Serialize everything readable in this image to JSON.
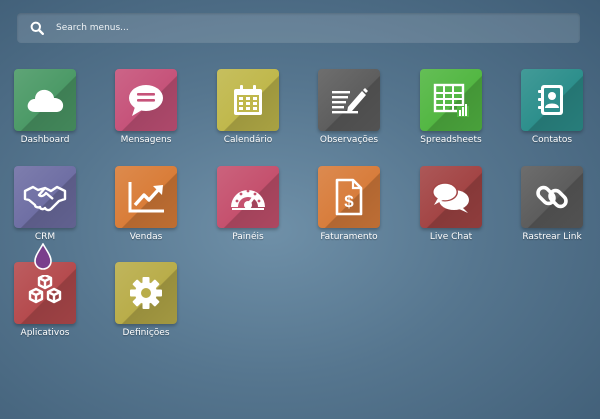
{
  "search": {
    "placeholder": "Search menus..."
  },
  "apps": [
    {
      "label": "Dashboard",
      "icon": "cloud-icon",
      "color": "#4c9a67"
    },
    {
      "label": "Mensagens",
      "icon": "chat-bubble-icon",
      "color": "#c6537a"
    },
    {
      "label": "Calendário",
      "icon": "calendar-icon",
      "color": "#c0b84c"
    },
    {
      "label": "Observações",
      "icon": "notes-pencil-icon",
      "color": "#5e5e5e"
    },
    {
      "label": "Spreadsheets",
      "icon": "spreadsheet-icon",
      "color": "#53b743"
    },
    {
      "label": "Contatos",
      "icon": "contact-book-icon",
      "color": "#2d8f8c"
    },
    {
      "label": "CRM",
      "icon": "handshake-icon",
      "color": "#6f6fa4"
    },
    {
      "label": "Vendas",
      "icon": "trend-chart-icon",
      "color": "#d97d39"
    },
    {
      "label": "Painéis",
      "icon": "gauge-icon",
      "color": "#c5516e"
    },
    {
      "label": "Faturamento",
      "icon": "invoice-dollar-icon",
      "color": "#d87d3c"
    },
    {
      "label": "Live Chat",
      "icon": "two-bubbles-icon",
      "color": "#a34545"
    },
    {
      "label": "Rastrear Link",
      "icon": "chain-link-icon",
      "color": "#5d5d5d"
    },
    {
      "label": "Aplicativos",
      "icon": "cubes-icon",
      "color": "#b54b4e"
    },
    {
      "label": "Definições",
      "icon": "gear-icon",
      "color": "#b9ad4a"
    }
  ]
}
